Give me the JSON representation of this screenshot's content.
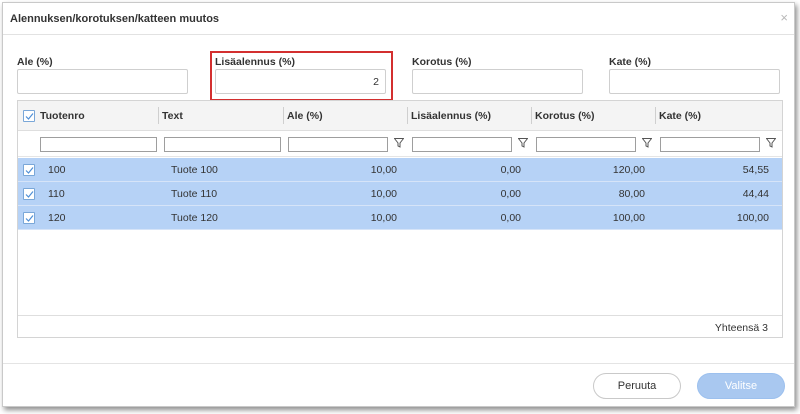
{
  "dialog": {
    "title": "Alennuksen/korotuksen/katteen muutos",
    "close_glyph": "×"
  },
  "fields": [
    {
      "label": "Ale (%)",
      "value": ""
    },
    {
      "label": "Lisäalennus (%)",
      "value": "2",
      "highlighted": true
    },
    {
      "label": "Korotus (%)",
      "value": ""
    },
    {
      "label": "Kate (%)",
      "value": ""
    }
  ],
  "grid": {
    "columns": [
      "Tuotenro",
      "Text",
      "Ale (%)",
      "Lisäalennus (%)",
      "Korotus (%)",
      "Kate (%)"
    ],
    "rows": [
      {
        "tuotenro": "100",
        "text": "Tuote 100",
        "ale": "10,00",
        "lisaalennus": "0,00",
        "korotus": "120,00",
        "kate": "54,55",
        "selected": true
      },
      {
        "tuotenro": "110",
        "text": "Tuote 110",
        "ale": "10,00",
        "lisaalennus": "0,00",
        "korotus": "80,00",
        "kate": "44,44",
        "selected": true
      },
      {
        "tuotenro": "120",
        "text": "Tuote 120",
        "ale": "10,00",
        "lisaalennus": "0,00",
        "korotus": "100,00",
        "kate": "100,00",
        "selected": true
      }
    ],
    "footer_total": "Yhteensä 3",
    "filter_icon": "funnel-icon"
  },
  "buttons": {
    "cancel": "Peruuta",
    "ok": "Valitse"
  },
  "colors": {
    "selected_row": "#b6d2f6",
    "highlight_border": "#d32f2f",
    "primary_button": "#a9c8f0"
  }
}
